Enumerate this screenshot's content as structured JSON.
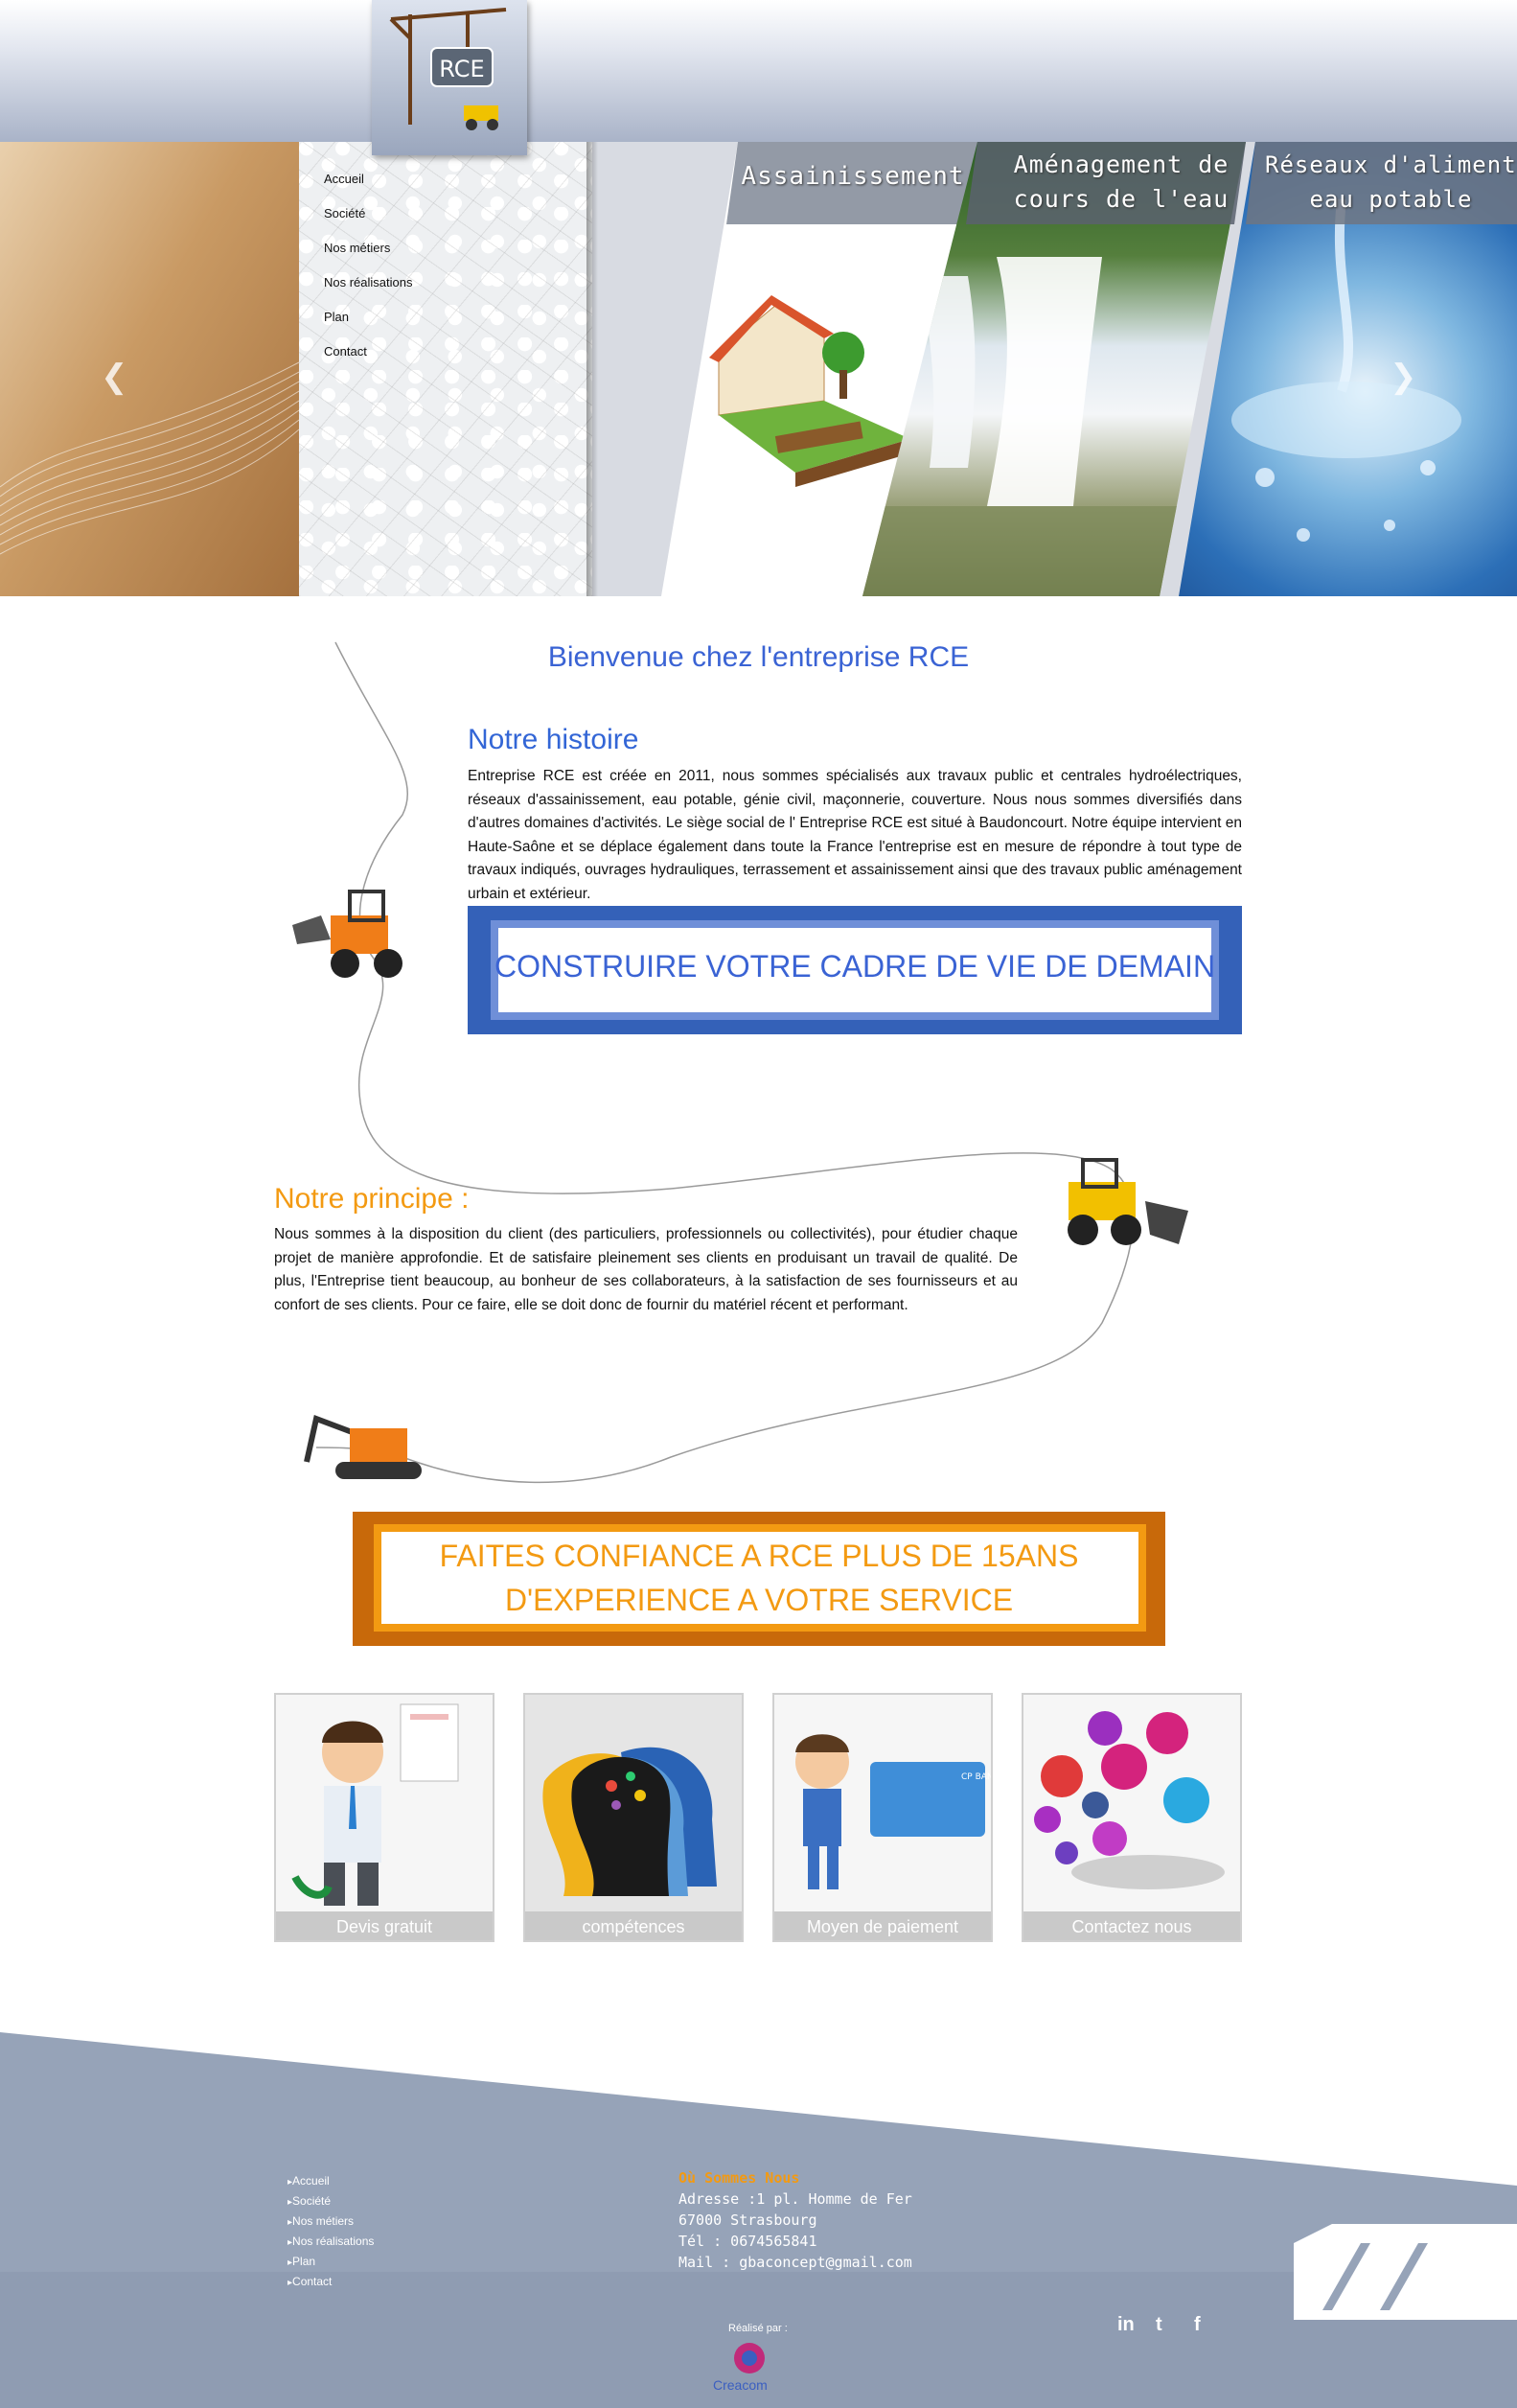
{
  "header": {
    "logo_text": "RCE",
    "menu": [
      "Accueil",
      "Société",
      "Nos métiers",
      "Nos réalisations",
      "Plan",
      "Contact"
    ],
    "slides": [
      {
        "title": "Assainissement"
      },
      {
        "title_line1": "Aménagement de",
        "title_line2": "cours de l'eau"
      },
      {
        "title_line1": "Réseaux d'alimentation",
        "title_line2": "eau potable"
      }
    ]
  },
  "main": {
    "welcome": "Bienvenue chez  l'entreprise RCE",
    "histoire_title": "Notre histoire",
    "histoire_body": "Entreprise RCE est  créée en 2011, nous sommes spécialisés aux travaux public et centrales hydroélectriques, réseaux d'assainissement, eau potable, génie civil, maçonnerie, couverture. Nous nous sommes diversifiés dans d'autres domaines d'activités. Le siège social de l' Entreprise RCE est situé à Baudoncourt. Notre équipe intervient en Haute-Saône et se déplace également dans toute la France l'entreprise  est en mesure de répondre à tout type de travaux indiqués, ouvrages hydrauliques, terrassement et assainissement ainsi que des travaux public aménagement urbain et extérieur.",
    "banner1": "CONSTRUIRE VOTRE CADRE DE VIE DE DEMAIN",
    "principe_title": "Notre principe :",
    "principe_body": "Nous sommes à la disposition du client (des particuliers, professionnels ou collectivités), pour étudier chaque projet de manière approfondie. Et de satisfaire pleinement ses clients en produisant un travail de qualité. De plus, l'Entreprise tient beaucoup, au bonheur de ses collaborateurs, à la satisfaction de ses fournisseurs et au confort de ses clients. Pour ce faire, elle se doit donc de fournir du matériel récent et performant.",
    "banner2_line1": "FAITES CONFIANCE A RCE PLUS DE 15ANS",
    "banner2_line2": "D'EXPERIENCE A VOTRE SERVICE",
    "cards": [
      "Devis gratuit",
      "compétences",
      "Moyen de paiement",
      "Contactez nous"
    ],
    "card_bank": "CP BANK"
  },
  "footer": {
    "links": [
      "Accueil",
      "Société",
      "Nos métiers",
      "Nos réalisations",
      "Plan",
      "Contact"
    ],
    "where_title": "Où Sommes Nous",
    "address": "Adresse :1 pl. Homme de Fer",
    "city": "67000 Strasbourg",
    "tel": "Tél : 0674565841",
    "mail": "Mail : gbaconcept@gmail.com",
    "realise": "Réalisé par :",
    "creacom": "Creacom",
    "social": [
      "in",
      "t",
      "f"
    ]
  },
  "colors": {
    "blue": "#3a63d4",
    "orange": "#f39a12",
    "footer": "#96a3b8"
  }
}
